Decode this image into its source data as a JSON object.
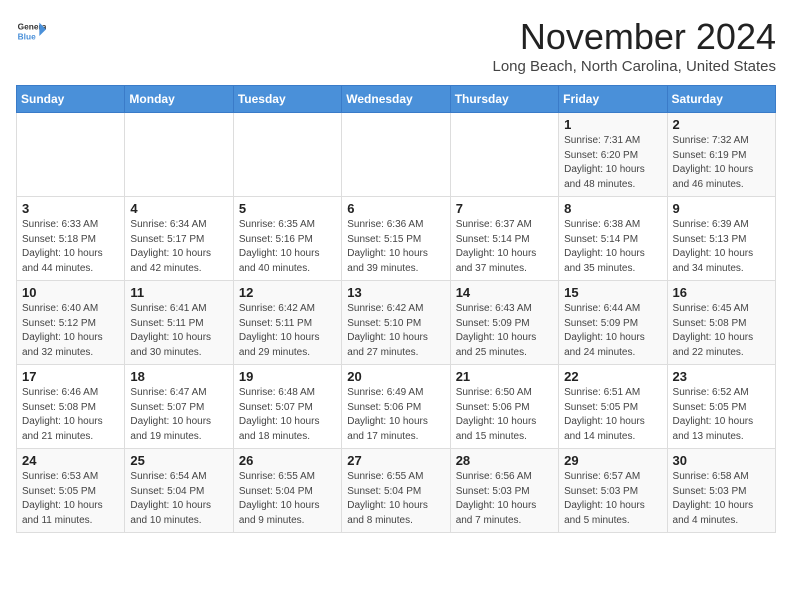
{
  "logo": {
    "general": "General",
    "blue": "Blue"
  },
  "header": {
    "month_title": "November 2024",
    "location": "Long Beach, North Carolina, United States"
  },
  "days_of_week": [
    "Sunday",
    "Monday",
    "Tuesday",
    "Wednesday",
    "Thursday",
    "Friday",
    "Saturday"
  ],
  "weeks": [
    [
      {
        "day": "",
        "info": ""
      },
      {
        "day": "",
        "info": ""
      },
      {
        "day": "",
        "info": ""
      },
      {
        "day": "",
        "info": ""
      },
      {
        "day": "",
        "info": ""
      },
      {
        "day": "1",
        "info": "Sunrise: 7:31 AM\nSunset: 6:20 PM\nDaylight: 10 hours\nand 48 minutes."
      },
      {
        "day": "2",
        "info": "Sunrise: 7:32 AM\nSunset: 6:19 PM\nDaylight: 10 hours\nand 46 minutes."
      }
    ],
    [
      {
        "day": "3",
        "info": "Sunrise: 6:33 AM\nSunset: 5:18 PM\nDaylight: 10 hours\nand 44 minutes."
      },
      {
        "day": "4",
        "info": "Sunrise: 6:34 AM\nSunset: 5:17 PM\nDaylight: 10 hours\nand 42 minutes."
      },
      {
        "day": "5",
        "info": "Sunrise: 6:35 AM\nSunset: 5:16 PM\nDaylight: 10 hours\nand 40 minutes."
      },
      {
        "day": "6",
        "info": "Sunrise: 6:36 AM\nSunset: 5:15 PM\nDaylight: 10 hours\nand 39 minutes."
      },
      {
        "day": "7",
        "info": "Sunrise: 6:37 AM\nSunset: 5:14 PM\nDaylight: 10 hours\nand 37 minutes."
      },
      {
        "day": "8",
        "info": "Sunrise: 6:38 AM\nSunset: 5:14 PM\nDaylight: 10 hours\nand 35 minutes."
      },
      {
        "day": "9",
        "info": "Sunrise: 6:39 AM\nSunset: 5:13 PM\nDaylight: 10 hours\nand 34 minutes."
      }
    ],
    [
      {
        "day": "10",
        "info": "Sunrise: 6:40 AM\nSunset: 5:12 PM\nDaylight: 10 hours\nand 32 minutes."
      },
      {
        "day": "11",
        "info": "Sunrise: 6:41 AM\nSunset: 5:11 PM\nDaylight: 10 hours\nand 30 minutes."
      },
      {
        "day": "12",
        "info": "Sunrise: 6:42 AM\nSunset: 5:11 PM\nDaylight: 10 hours\nand 29 minutes."
      },
      {
        "day": "13",
        "info": "Sunrise: 6:42 AM\nSunset: 5:10 PM\nDaylight: 10 hours\nand 27 minutes."
      },
      {
        "day": "14",
        "info": "Sunrise: 6:43 AM\nSunset: 5:09 PM\nDaylight: 10 hours\nand 25 minutes."
      },
      {
        "day": "15",
        "info": "Sunrise: 6:44 AM\nSunset: 5:09 PM\nDaylight: 10 hours\nand 24 minutes."
      },
      {
        "day": "16",
        "info": "Sunrise: 6:45 AM\nSunset: 5:08 PM\nDaylight: 10 hours\nand 22 minutes."
      }
    ],
    [
      {
        "day": "17",
        "info": "Sunrise: 6:46 AM\nSunset: 5:08 PM\nDaylight: 10 hours\nand 21 minutes."
      },
      {
        "day": "18",
        "info": "Sunrise: 6:47 AM\nSunset: 5:07 PM\nDaylight: 10 hours\nand 19 minutes."
      },
      {
        "day": "19",
        "info": "Sunrise: 6:48 AM\nSunset: 5:07 PM\nDaylight: 10 hours\nand 18 minutes."
      },
      {
        "day": "20",
        "info": "Sunrise: 6:49 AM\nSunset: 5:06 PM\nDaylight: 10 hours\nand 17 minutes."
      },
      {
        "day": "21",
        "info": "Sunrise: 6:50 AM\nSunset: 5:06 PM\nDaylight: 10 hours\nand 15 minutes."
      },
      {
        "day": "22",
        "info": "Sunrise: 6:51 AM\nSunset: 5:05 PM\nDaylight: 10 hours\nand 14 minutes."
      },
      {
        "day": "23",
        "info": "Sunrise: 6:52 AM\nSunset: 5:05 PM\nDaylight: 10 hours\nand 13 minutes."
      }
    ],
    [
      {
        "day": "24",
        "info": "Sunrise: 6:53 AM\nSunset: 5:05 PM\nDaylight: 10 hours\nand 11 minutes."
      },
      {
        "day": "25",
        "info": "Sunrise: 6:54 AM\nSunset: 5:04 PM\nDaylight: 10 hours\nand 10 minutes."
      },
      {
        "day": "26",
        "info": "Sunrise: 6:55 AM\nSunset: 5:04 PM\nDaylight: 10 hours\nand 9 minutes."
      },
      {
        "day": "27",
        "info": "Sunrise: 6:55 AM\nSunset: 5:04 PM\nDaylight: 10 hours\nand 8 minutes."
      },
      {
        "day": "28",
        "info": "Sunrise: 6:56 AM\nSunset: 5:03 PM\nDaylight: 10 hours\nand 7 minutes."
      },
      {
        "day": "29",
        "info": "Sunrise: 6:57 AM\nSunset: 5:03 PM\nDaylight: 10 hours\nand 5 minutes."
      },
      {
        "day": "30",
        "info": "Sunrise: 6:58 AM\nSunset: 5:03 PM\nDaylight: 10 hours\nand 4 minutes."
      }
    ]
  ]
}
